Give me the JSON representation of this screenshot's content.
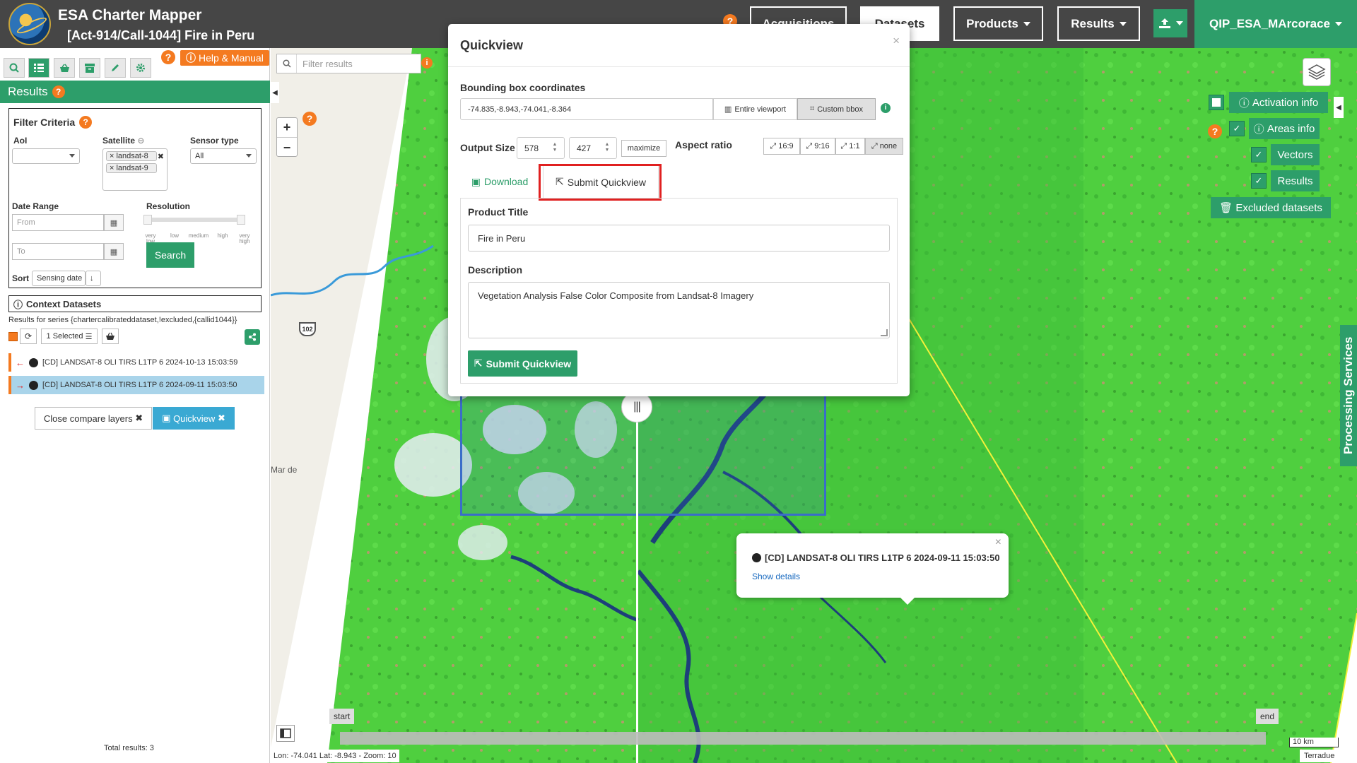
{
  "header": {
    "title": "ESA Charter Mapper",
    "subtitle": "[Act-914/Call-1044] Fire in Peru",
    "help": "?",
    "nav": {
      "acquisitions": "Acquisitions",
      "datasets": "Datasets",
      "products": "Products",
      "results": "Results"
    },
    "user": "QIP_ESA_MArcorace",
    "colors": {
      "bar": "#464646",
      "accent": "#2d9e6a",
      "help": "#f47a20"
    }
  },
  "left_panel": {
    "help_manual": "Help & Manual",
    "results_title": "Results",
    "filter": {
      "title": "Filter Criteria",
      "aoi_label": "AoI",
      "aoi_value": "",
      "satellite_label": "Satellite",
      "satellite_tags": [
        "landsat-8",
        "landsat-9"
      ],
      "sensor_label": "Sensor type",
      "sensor_value": "All",
      "date_range_label": "Date Range",
      "from_placeholder": "From",
      "to_placeholder": "To",
      "resolution_label": "Resolution",
      "resolution_ticks": [
        "very low",
        "low",
        "medium",
        "high",
        "very high"
      ],
      "search": "Search",
      "sort_label": "Sort",
      "sort_value": "Sensing date"
    },
    "context": {
      "title": "Context Datasets",
      "series": "Results for series {chartercalibrateddataset,!excluded,{callid1044}}",
      "selected": "1 Selected"
    },
    "items": [
      {
        "label": "[CD] LANDSAT-8 OLI TIRS L1TP 6 2024-10-13 15:03:59"
      },
      {
        "label": "[CD] LANDSAT-8 OLI TIRS L1TP 6 2024-09-11 15:03:50"
      }
    ],
    "close_compare": "Close compare layers",
    "quickview": "Quickview",
    "total_results": "Total results: 3"
  },
  "map": {
    "filter_placeholder": "Filter results",
    "zoom_in": "+",
    "zoom_out": "−",
    "layers": {
      "activation_info": "Activation info",
      "areas_info": "Areas info",
      "vectors": "Vectors",
      "results": "Results",
      "excluded": "Excluded datasets"
    },
    "processing_services": "Processing Services",
    "popup": {
      "title": "[CD] LANDSAT-8 OLI TIRS L1TP 6 2024-09-11 15:03:50",
      "link": "Show details"
    },
    "place_label": "Mar de",
    "road_label": "102",
    "timeline": {
      "start": "start",
      "end": "end"
    },
    "scale": "10 km",
    "coords": "Lon: -74.041 Lat: -8.943 - Zoom: 10",
    "attribution": "Terradue"
  },
  "modal": {
    "title": "Quickview",
    "close": "×",
    "bbox_label": "Bounding box coordinates",
    "bbox_value": "-74.835,-8.943,-74.041,-8.364",
    "entire_viewport": "Entire viewport",
    "custom_bbox": "Custom bbox",
    "output_size_label": "Output Size",
    "width": "578",
    "height": "427",
    "maximize": "maximize",
    "aspect_ratio_label": "Aspect ratio",
    "aspect_ratios": [
      "16:9",
      "9:16",
      "1:1",
      "none"
    ],
    "tabs": {
      "download": "Download",
      "submit": "Submit Quickview"
    },
    "product_title_label": "Product Title",
    "product_title_value": "Fire in Peru",
    "description_label": "Description",
    "description_value": "Vegetation Analysis False Color Composite from Landsat-8 Imagery",
    "submit_button": "Submit Quickview"
  }
}
